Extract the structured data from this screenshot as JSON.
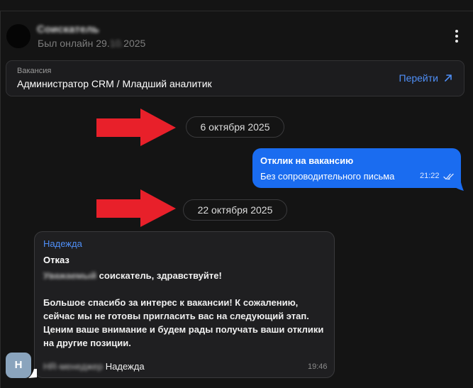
{
  "header": {
    "contact_name": "Соискатель",
    "last_seen_prefix": "Был онлайн 29.",
    "last_seen_blurred": "10.",
    "last_seen_suffix": "2025",
    "menu_icon": "kebab-menu-icon"
  },
  "vacancy": {
    "label": "Вакансия",
    "title": "Администратор CRM / Младший аналитик",
    "go_label": "Перейти",
    "go_icon": "arrow-up-right-icon"
  },
  "dates": {
    "first": "6 октября 2025",
    "second": "22 октября 2025"
  },
  "outgoing": {
    "title": "Отклик на вакансию",
    "text": "Без сопроводительного письма",
    "time": "21:22",
    "status_icon": "double-check-icon"
  },
  "incoming": {
    "sender": "Надежда",
    "subject": "Отказ",
    "greeting_blurred": "Уважаемый",
    "greeting_rest": " соискатель, здравствуйте!",
    "body_1": "Большое спасибо за интерес к вакансии! К сожалению, сейчас мы не готовы пригласить вас на следующий этап.",
    "body_2": "Ценим ваше внимание и будем рады получать ваши отклики на другие позиции.",
    "sign_blurred": "HR-менеджер",
    "sign_name": "Надежда",
    "time": "19:46",
    "avatar_letter": "Н"
  },
  "colors": {
    "background": "#141414",
    "accent": "#4f8ff7",
    "outgoing_bubble": "#1a6cf0",
    "incoming_bubble": "#1f1f21",
    "annotation_arrow": "#e8202a",
    "avatar": "#8aa4bd"
  }
}
